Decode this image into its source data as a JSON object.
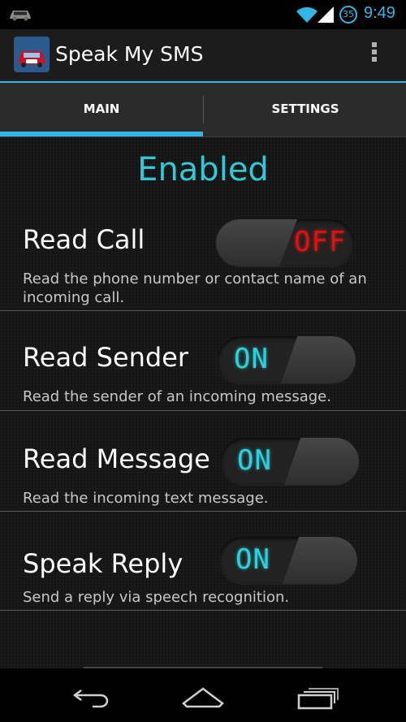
{
  "status_bar": {
    "battery_level": "35",
    "time": "9:49",
    "icons": [
      "car-icon",
      "wifi-icon",
      "signal-icon",
      "battery-icon"
    ]
  },
  "action_bar": {
    "title": "Speak My SMS",
    "icons": [
      "app-logo-icon",
      "overflow-menu-icon"
    ]
  },
  "tabs": [
    {
      "label": "MAIN",
      "selected": true
    },
    {
      "label": "SETTINGS",
      "selected": false
    }
  ],
  "main": {
    "status_title": "Enabled",
    "settings": [
      {
        "label": "Read Call",
        "description": "Read the phone number or contact name of an incoming call.",
        "toggle": "OFF"
      },
      {
        "label": "Read Sender",
        "description": "Read the sender of an incoming message.",
        "toggle": "ON"
      },
      {
        "label": "Read Message",
        "description": "Read the incoming text message.",
        "toggle": "ON"
      },
      {
        "label": "Speak Reply",
        "description": "Send a reply via speech recognition.",
        "toggle": "ON"
      }
    ]
  },
  "nav_bar": {
    "icons": [
      "back-icon",
      "home-icon",
      "recent-apps-icon"
    ]
  },
  "colors": {
    "accent": "#33b5e5",
    "enabled_text": "#33c8d8",
    "toggle_on": "#2fd0dc",
    "toggle_off": "#e01010",
    "background": "#161616"
  }
}
